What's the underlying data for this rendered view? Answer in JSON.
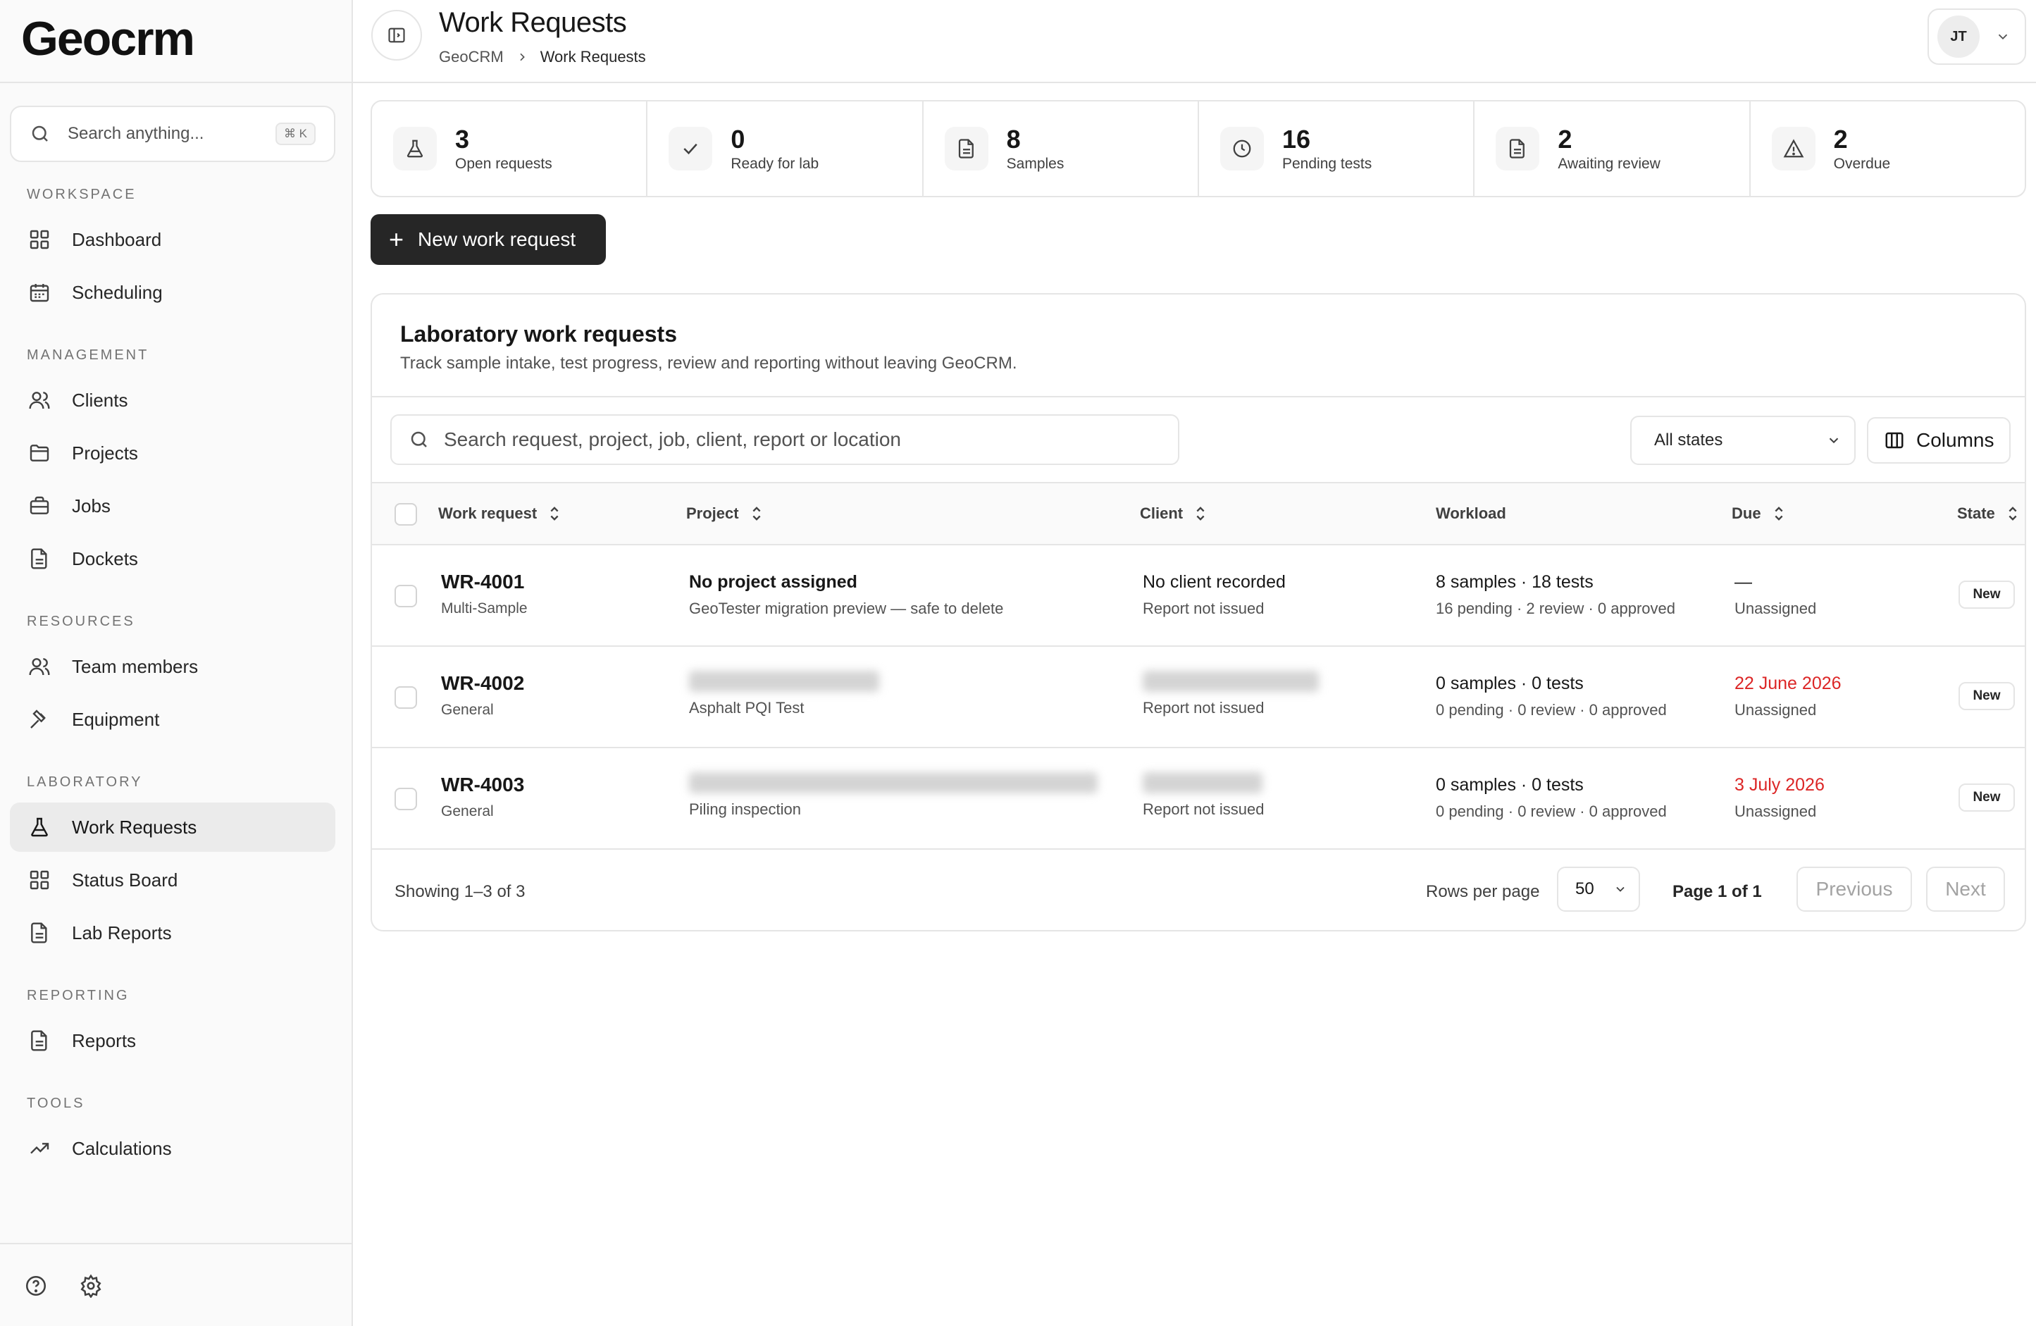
{
  "app": {
    "name": "Geocrm"
  },
  "sidebar": {
    "search_placeholder": "Search anything...",
    "search_shortcut": "⌘ K",
    "sections": {
      "workspace": "WORKSPACE",
      "management": "MANAGEMENT",
      "resources": "RESOURCES",
      "laboratory": "LABORATORY",
      "reporting": "REPORTING",
      "tools": "TOOLS"
    },
    "items": {
      "dashboard": "Dashboard",
      "scheduling": "Scheduling",
      "clients": "Clients",
      "projects": "Projects",
      "jobs": "Jobs",
      "dockets": "Dockets",
      "team_members": "Team members",
      "equipment": "Equipment",
      "work_requests": "Work Requests",
      "status_board": "Status Board",
      "lab_reports": "Lab Reports",
      "reports": "Reports",
      "calculations": "Calculations"
    },
    "active_item": "work_requests"
  },
  "header": {
    "title": "Work Requests",
    "breadcrumb": [
      "GeoCRM",
      "Work Requests"
    ],
    "user_initials": "JT"
  },
  "stats": [
    {
      "value": "3",
      "label": "Open requests",
      "icon": "flask-icon"
    },
    {
      "value": "0",
      "label": "Ready for lab",
      "icon": "check-icon"
    },
    {
      "value": "8",
      "label": "Samples",
      "icon": "file-icon"
    },
    {
      "value": "16",
      "label": "Pending tests",
      "icon": "clock-icon"
    },
    {
      "value": "2",
      "label": "Awaiting review",
      "icon": "file-icon"
    },
    {
      "value": "2",
      "label": "Overdue",
      "icon": "warning-icon"
    }
  ],
  "new_button_label": "New work request",
  "card": {
    "title": "Laboratory work requests",
    "description": "Track sample intake, test progress, review and reporting without leaving GeoCRM.",
    "search_placeholder": "Search request, project, job, client, report or location",
    "state_filter": "All states",
    "columns_label": "Columns"
  },
  "table": {
    "columns": [
      "Work request",
      "Project",
      "Client",
      "Workload",
      "Due",
      "State"
    ],
    "rows": [
      {
        "id": "WR-4001",
        "type": "Multi-Sample",
        "project_title": "No project assigned",
        "project_sub": "GeoTester migration preview — safe to delete",
        "client_title": "No client recorded",
        "client_sub": "Report not issued",
        "workload_main": "8 samples · 18 tests",
        "workload_sub": "16 pending · 2 review · 0 approved",
        "due": "—",
        "assignee": "Unassigned",
        "state": "New"
      },
      {
        "id": "WR-4002",
        "type": "General",
        "project_title": "",
        "project_sub": "Asphalt PQI Test",
        "client_title": "",
        "client_sub": "Report not issued",
        "workload_main": "0 samples · 0 tests",
        "workload_sub": "0 pending · 0 review · 0 approved",
        "due": "22 June 2026",
        "assignee": "Unassigned",
        "state": "New"
      },
      {
        "id": "WR-4003",
        "type": "General",
        "project_title": "",
        "project_sub": "Piling inspection",
        "client_title": "",
        "client_sub": "Report not issued",
        "workload_main": "0 samples · 0 tests",
        "workload_sub": "0 pending · 0 review · 0 approved",
        "due": "3 July 2026",
        "assignee": "Unassigned",
        "state": "New"
      }
    ],
    "footer": {
      "showing": "Showing 1–3 of 3",
      "rows_per_page_label": "Rows per page",
      "rows_per_page": "50",
      "page_info": "Page 1 of 1",
      "previous": "Previous",
      "next": "Next"
    }
  },
  "colors": {
    "accent_dark": "#262626",
    "overdue_red": "#dc2626",
    "border": "#e5e5e5"
  }
}
